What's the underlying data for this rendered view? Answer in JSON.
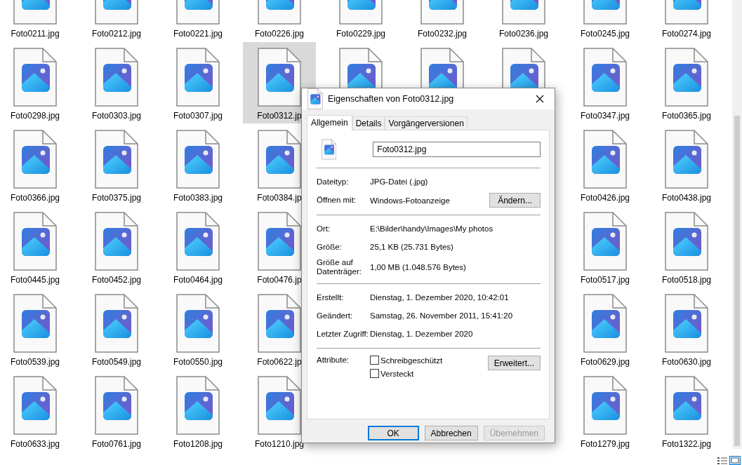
{
  "file_rows": [
    {
      "left": [
        {
          "name": "Foto0211.jpg",
          "selected": false
        },
        {
          "name": "Foto0212.jpg",
          "selected": false
        },
        {
          "name": "Foto0221.jpg",
          "selected": false
        },
        {
          "name": "Foto0226.jpg",
          "selected": false
        },
        {
          "name": "Foto0229.jpg",
          "selected": false
        },
        {
          "name": "Foto0232.jpg",
          "selected": false
        },
        {
          "name": "Foto0236.jpg",
          "selected": false
        },
        {
          "name": "Foto0245.jpg",
          "selected": false
        },
        {
          "name": "Foto0274.jpg",
          "selected": false
        }
      ]
    },
    {
      "left": [
        {
          "name": "Foto0298.jpg",
          "selected": false
        },
        {
          "name": "Foto0303.jpg",
          "selected": false
        },
        {
          "name": "Foto0307.jpg",
          "selected": false
        },
        {
          "name": "Foto0312.jp",
          "selected": true
        }
      ],
      "right": [
        {
          "name": "Foto0347.jpg",
          "selected": false
        },
        {
          "name": "Foto0365.jpg",
          "selected": false
        }
      ]
    },
    {
      "left": [
        {
          "name": "Foto0366.jpg",
          "selected": false
        },
        {
          "name": "Foto0375.jpg",
          "selected": false
        },
        {
          "name": "Foto0383.jpg",
          "selected": false
        },
        {
          "name": "Foto0384.jp",
          "selected": false
        }
      ],
      "right": [
        {
          "name": "Foto0426.jpg",
          "selected": false
        },
        {
          "name": "Foto0438.jpg",
          "selected": false
        }
      ]
    },
    {
      "left": [
        {
          "name": "Foto0445.jpg",
          "selected": false
        },
        {
          "name": "Foto0452.jpg",
          "selected": false
        },
        {
          "name": "Foto0464.jpg",
          "selected": false
        },
        {
          "name": "Foto0476.jp",
          "selected": false
        }
      ],
      "right": [
        {
          "name": "Foto0517.jpg",
          "selected": false
        },
        {
          "name": "Foto0518.jpg",
          "selected": false
        }
      ]
    },
    {
      "left": [
        {
          "name": "Foto0539.jpg",
          "selected": false
        },
        {
          "name": "Foto0549.jpg",
          "selected": false
        },
        {
          "name": "Foto0550.jpg",
          "selected": false
        },
        {
          "name": "Foto0622.jp",
          "selected": false
        }
      ],
      "right": [
        {
          "name": "Foto0629.jpg",
          "selected": false
        },
        {
          "name": "Foto0630.jpg",
          "selected": false
        }
      ]
    },
    {
      "left": [
        {
          "name": "Foto0633.jpg",
          "selected": false
        },
        {
          "name": "Foto0761.jpg",
          "selected": false
        },
        {
          "name": "Foto1208.jpg",
          "selected": false
        },
        {
          "name": "Foto1210.jpg",
          "selected": false
        }
      ],
      "right": [
        {
          "name": "Foto1279.jpg",
          "selected": false
        },
        {
          "name": "Foto1322.jpg",
          "selected": false
        }
      ]
    }
  ],
  "dialog": {
    "title": "Eigenschaften von Foto0312.jpg",
    "tabs": [
      {
        "label": "Allgemein",
        "selected": true
      },
      {
        "label": "Details",
        "selected": false
      },
      {
        "label": "Vorgängerversionen",
        "selected": false
      }
    ],
    "filename": "Foto0312.jpg",
    "sections": [
      [
        {
          "label": "Dateityp:",
          "value": "JPG-Datei (.jpg)"
        },
        {
          "label": "Öffnen mit:",
          "value": "Windows-Fotoanzeige",
          "button": "Ändern..."
        }
      ],
      [
        {
          "label": "Ort:",
          "value": "E:\\Bilder\\handy\\Images\\My photos"
        },
        {
          "label": "Größe:",
          "value": "25,1 KB (25.731 Bytes)"
        },
        {
          "label": "Größe auf Datenträger:",
          "value": "1,00 MB (1.048.576 Bytes)"
        }
      ],
      [
        {
          "label": "Erstellt:",
          "value": "Dienstag, 1. Dezember 2020, 10:42:01"
        },
        {
          "label": "Geändert:",
          "value": "Samstag, 26. November 2011, 15:41:20"
        },
        {
          "label": "Letzter Zugriff:",
          "value": "Dienstag, 1. Dezember 2020"
        }
      ]
    ],
    "attributes": {
      "label": "Attribute:",
      "options": [
        {
          "label": "Schreibgeschützt",
          "checked": false
        },
        {
          "label": "Versteckt",
          "checked": false
        }
      ],
      "button": "Erweitert..."
    },
    "buttons": [
      {
        "label": "OK",
        "kind": "default",
        "disabled": false
      },
      {
        "label": "Abbrechen",
        "kind": "normal",
        "disabled": false
      },
      {
        "label": "Übernehmen",
        "kind": "normal",
        "disabled": true
      }
    ]
  }
}
